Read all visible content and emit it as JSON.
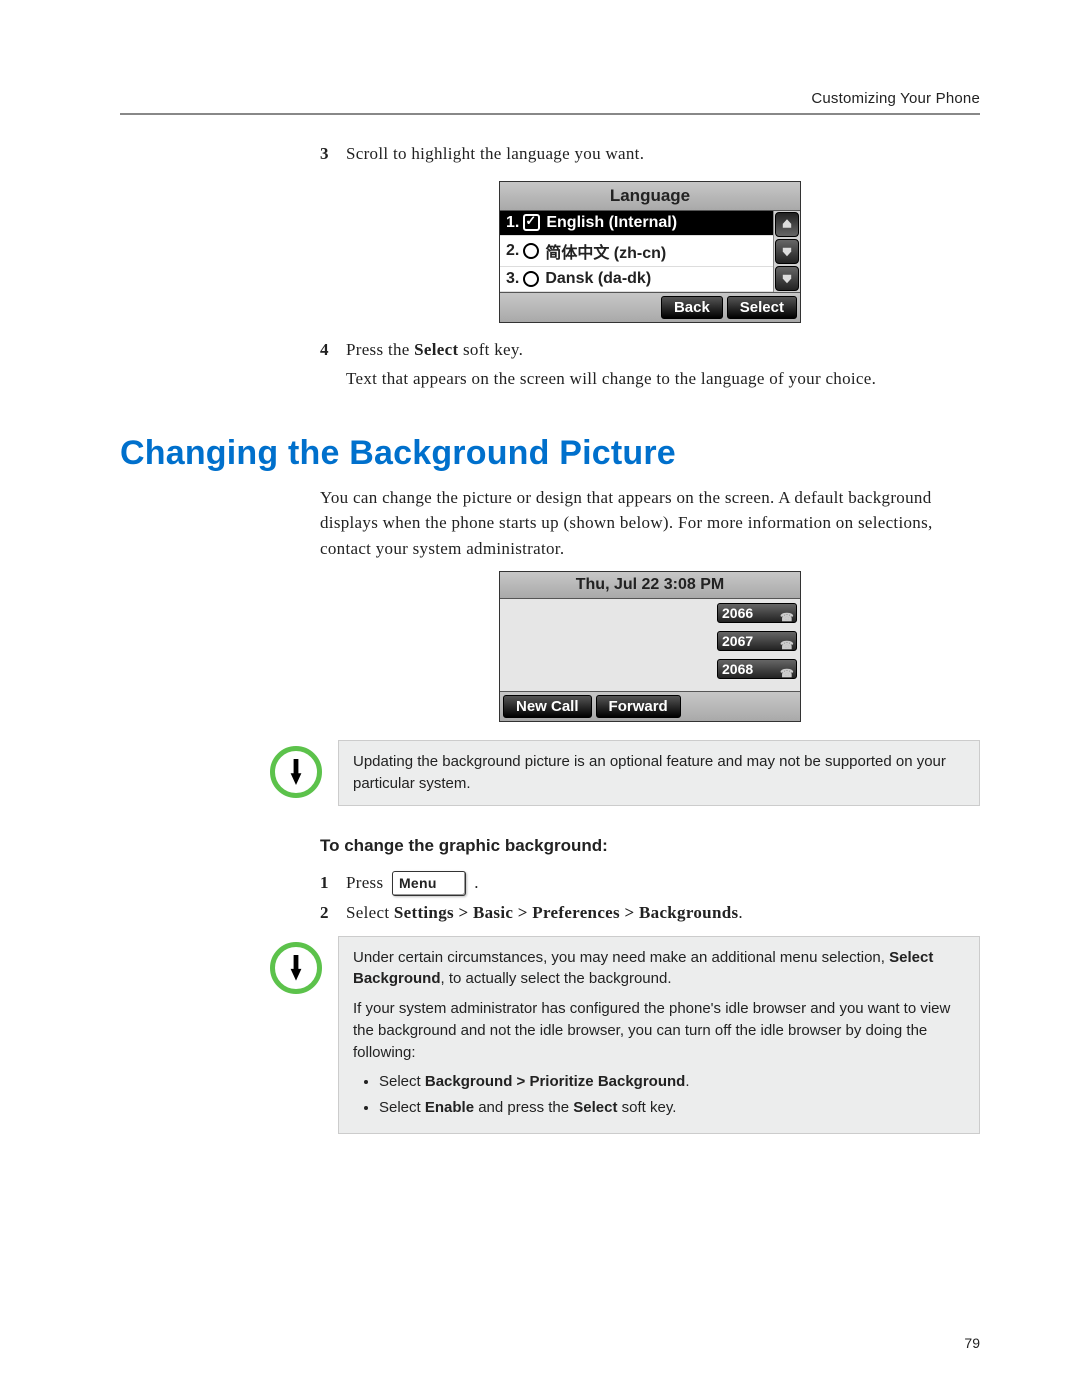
{
  "header": {
    "label": "Customizing Your Phone"
  },
  "step3": {
    "num": "3",
    "text": "Scroll to highlight the language you want."
  },
  "lang_screen": {
    "title": "Language",
    "items": [
      {
        "idx": "1.",
        "label": "English (Internal)",
        "selected": true
      },
      {
        "idx": "2.",
        "label": "简体中文 (zh-cn)",
        "selected": false
      },
      {
        "idx": "3.",
        "label": "Dansk (da-dk)",
        "selected": false
      }
    ],
    "softkeys": {
      "back": "Back",
      "select": "Select"
    }
  },
  "step4": {
    "num": "4",
    "prefix": "Press the ",
    "bold": "Select",
    "suffix": " soft key.",
    "followup": "Text that appears on the screen will change to the language of your choice."
  },
  "section": {
    "heading": "Changing the Background Picture"
  },
  "intro_para": "You can change the picture or design that appears on the screen. A default background displays when the phone starts up (shown below). For more information on selections, contact your system administrator.",
  "idle_screen": {
    "title": "Thu, Jul 22   3:08 PM",
    "lines": [
      "2066",
      "2067",
      "2068"
    ],
    "softkeys": {
      "newcall": "New Call",
      "forward": "Forward"
    }
  },
  "note1": "Updating the background picture is an optional feature and may not be supported on your particular system.",
  "sub_heading": "To change the graphic background:",
  "bstep1": {
    "num": "1",
    "prefix": "Press ",
    "key": "Menu",
    "suffix": " ."
  },
  "bstep2": {
    "num": "2",
    "prefix": "Select ",
    "bold": "Settings > Basic > Preferences > Backgrounds",
    "suffix": "."
  },
  "note2": {
    "line1a": "Under certain circumstances, you may need make an additional menu selection, ",
    "line1b": "Select Background",
    "line1c": ", to actually select the background.",
    "line2": "If your system administrator has configured the phone's idle browser and you want to view the background and not the idle browser, you can turn off the idle browser by doing the following:",
    "bullet1a": "Select ",
    "bullet1b": "Background > Prioritize Background",
    "bullet1c": ".",
    "bullet2a": "Select ",
    "bullet2b": "Enable",
    "bullet2c": " and press the ",
    "bullet2d": "Select",
    "bullet2e": " soft key."
  },
  "page_number": "79"
}
